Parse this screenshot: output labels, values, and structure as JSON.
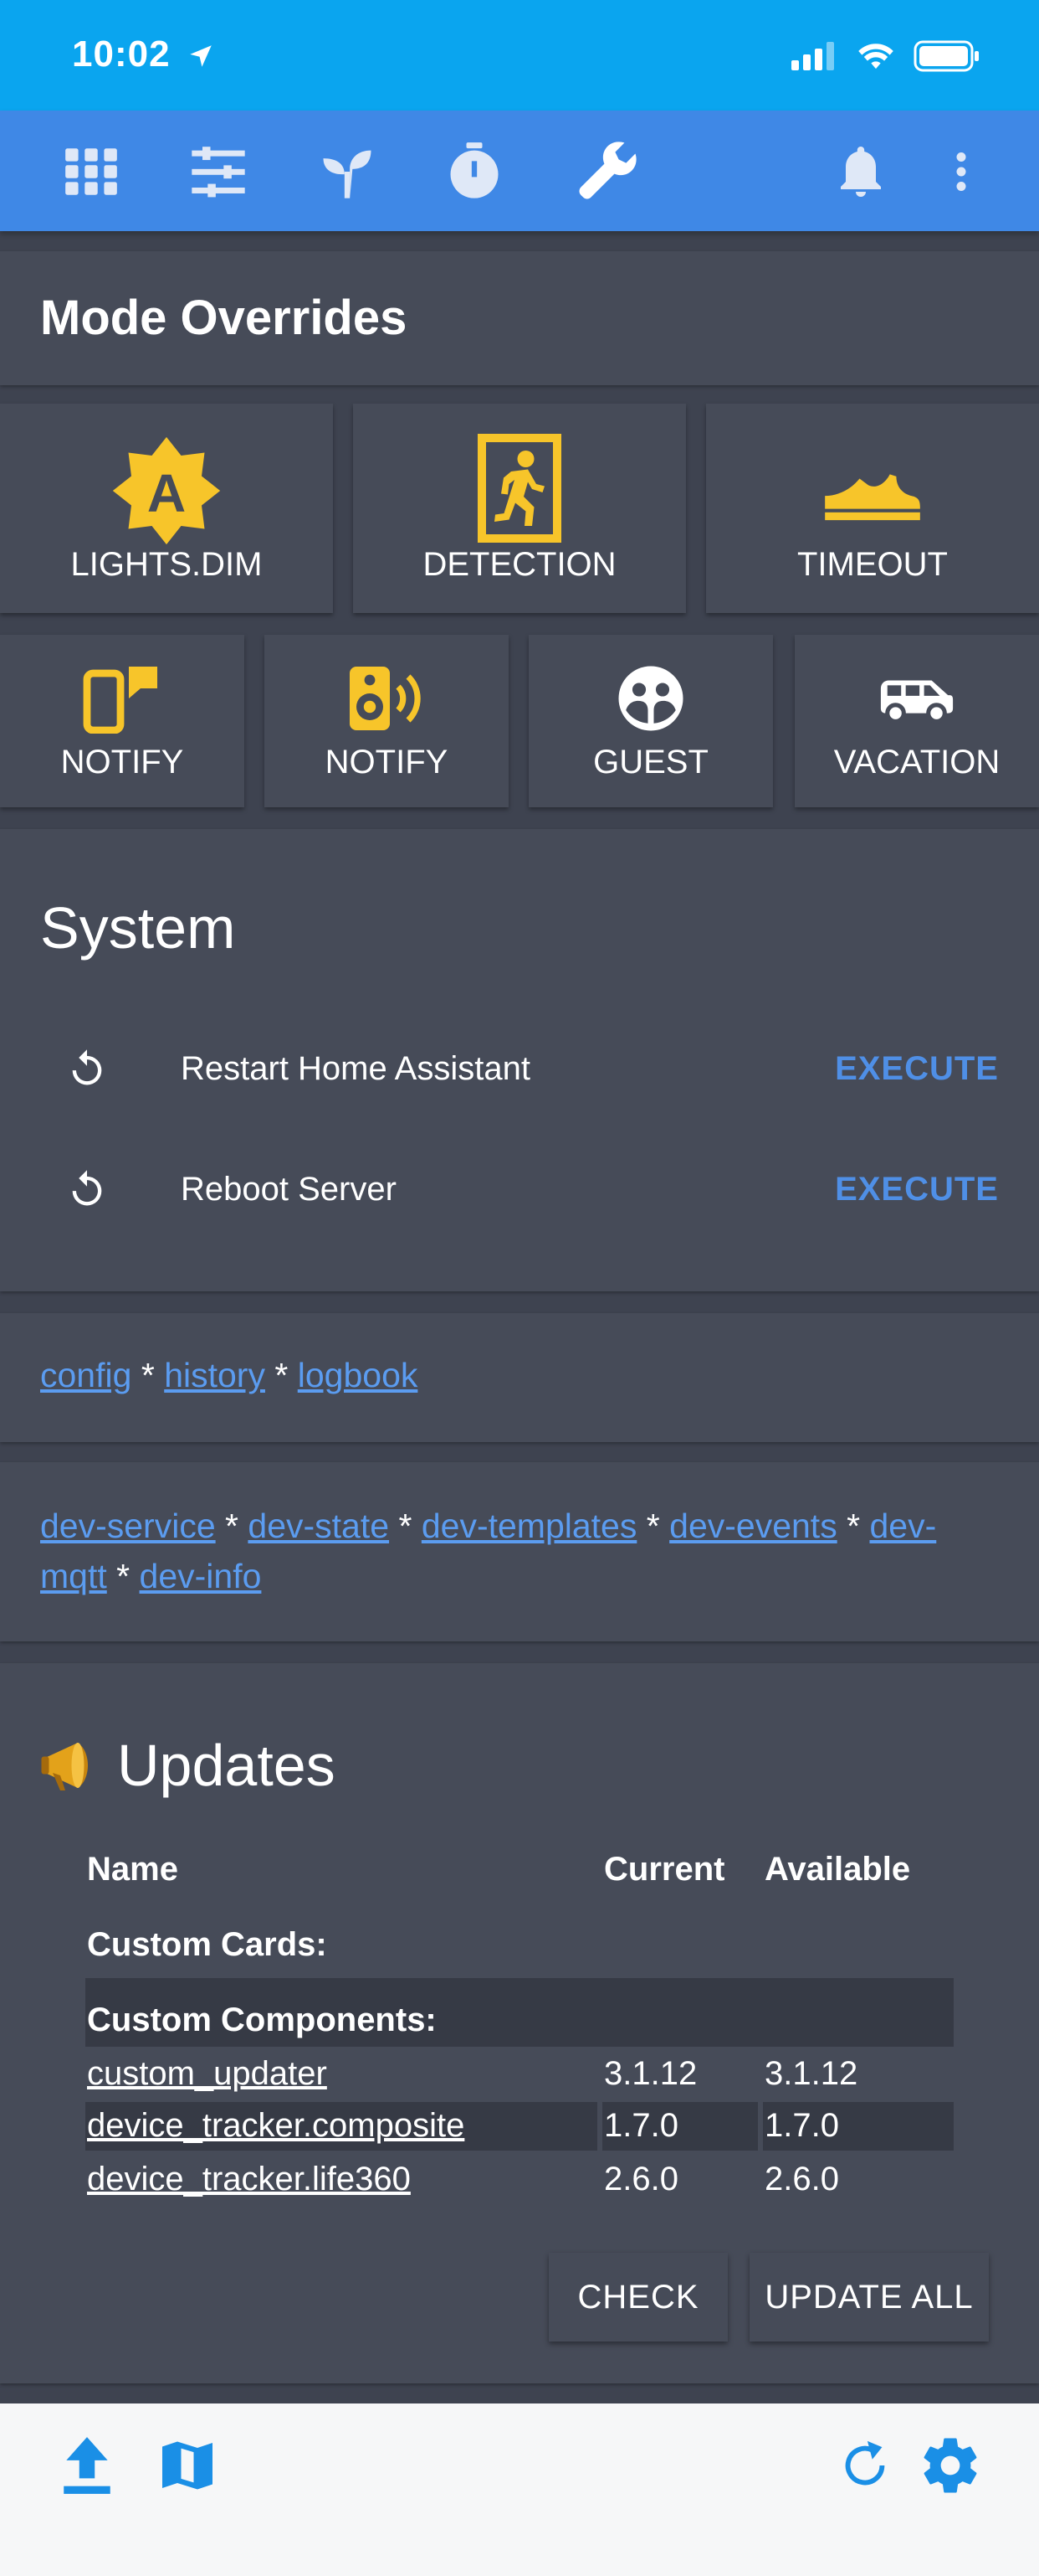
{
  "status_bar": {
    "time": "10:02"
  },
  "toolbar": {
    "tabs": [
      {
        "icon": "view-grid-icon"
      },
      {
        "icon": "tune-sliders-icon"
      },
      {
        "icon": "sprout-icon"
      },
      {
        "icon": "timer-icon"
      },
      {
        "icon": "wrench-icon",
        "active": true
      }
    ],
    "actions": [
      {
        "icon": "bell-icon"
      },
      {
        "icon": "more-vertical-icon"
      }
    ]
  },
  "mode_overrides": {
    "title": "Mode Overrides",
    "row1": [
      {
        "label": "LIGHTS.DIM",
        "icon": "auto-brightness-icon"
      },
      {
        "label": "DETECTION",
        "icon": "exit-run-icon"
      },
      {
        "label": "TIMEOUT",
        "icon": "shoe-icon"
      }
    ],
    "row2": [
      {
        "label": "NOTIFY",
        "icon": "cellphone-message-icon"
      },
      {
        "label": "NOTIFY",
        "icon": "speaker-wireless-icon"
      },
      {
        "label": "GUEST",
        "icon": "guest-icon"
      },
      {
        "label": "VACATION",
        "icon": "van-icon"
      }
    ]
  },
  "system": {
    "title": "System",
    "rows": [
      {
        "label": "Restart Home Assistant",
        "action": "EXECUTE"
      },
      {
        "label": "Reboot Server",
        "action": "EXECUTE"
      }
    ]
  },
  "links1": [
    "config",
    "history",
    "logbook"
  ],
  "links2": [
    "dev-service",
    "dev-state",
    "dev-templates",
    "dev-events",
    "dev-",
    "mqtt",
    "dev-info"
  ],
  "separator": "*",
  "updates": {
    "title": "Updates",
    "headers": {
      "name": "Name",
      "current": "Current",
      "available": "Available"
    },
    "section_cards": "Custom Cards:",
    "section_components": "Custom Components:",
    "rows": [
      {
        "name": "custom_updater",
        "current": "3.1.12",
        "available": "3.1.12"
      },
      {
        "name": "device_tracker.composite",
        "current": "1.7.0",
        "available": "1.7.0"
      },
      {
        "name": "device_tracker.life360",
        "current": "2.6.0",
        "available": "2.6.0"
      }
    ],
    "check_label": "CHECK",
    "update_all_label": "UPDATE ALL"
  },
  "bottom_bar": {
    "left": [
      {
        "icon": "share-upload-icon"
      },
      {
        "icon": "map-icon"
      }
    ],
    "right": [
      {
        "icon": "refresh-icon"
      },
      {
        "icon": "settings-gear-icon"
      }
    ]
  },
  "colors": {
    "status_bar": "#0aa5ef",
    "toolbar": "#3f88e6",
    "background": "#3e4350",
    "card": "#464b58",
    "accent_icon": "#f7c52a",
    "link": "#5b9cf0",
    "execute": "#4f8fe6"
  }
}
